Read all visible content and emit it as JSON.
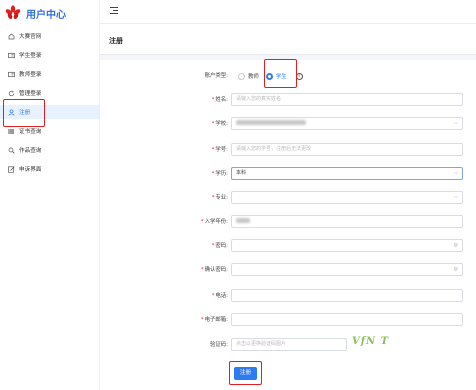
{
  "app": {
    "title": "用户中心"
  },
  "sidebar": {
    "items": [
      {
        "label": "大赛官网",
        "icon": "home-icon"
      },
      {
        "label": "学生登录",
        "icon": "id-card-icon"
      },
      {
        "label": "教师登录",
        "icon": "id-card-icon"
      },
      {
        "label": "管理登录",
        "icon": "refresh-icon"
      },
      {
        "label": "注册",
        "icon": "user-icon",
        "active": true
      },
      {
        "label": "证书查询",
        "icon": "barcode-icon"
      },
      {
        "label": "作品查询",
        "icon": "search-icon"
      },
      {
        "label": "申诉界面",
        "icon": "edit-icon"
      }
    ]
  },
  "page": {
    "title": "注册"
  },
  "form": {
    "account_type": {
      "label": "账户类型:",
      "options": [
        "教师",
        "学生"
      ],
      "selected": "学生"
    },
    "name": {
      "label": "姓名:",
      "placeholder": "请输入您的真实姓名"
    },
    "school": {
      "label": "学校:"
    },
    "student_no": {
      "label": "学号:",
      "placeholder": "请输入您的学号，注册后无法更改"
    },
    "education": {
      "label": "学历:",
      "value": "本科"
    },
    "major": {
      "label": "专业:"
    },
    "enroll_year": {
      "label": "入学年份:"
    },
    "password": {
      "label": "密码:"
    },
    "confirm_password": {
      "label": "确认密码:"
    },
    "phone": {
      "label": "电话:"
    },
    "email": {
      "label": "电子邮箱:"
    },
    "captcha": {
      "label": "验证码:",
      "placeholder": "点击以更换验证码图片",
      "image_text": "VfN T"
    },
    "submit_label": "注册"
  },
  "colors": {
    "accent": "#2f7cf0",
    "highlight": "#e02020",
    "brand": "#2f6fe0"
  }
}
